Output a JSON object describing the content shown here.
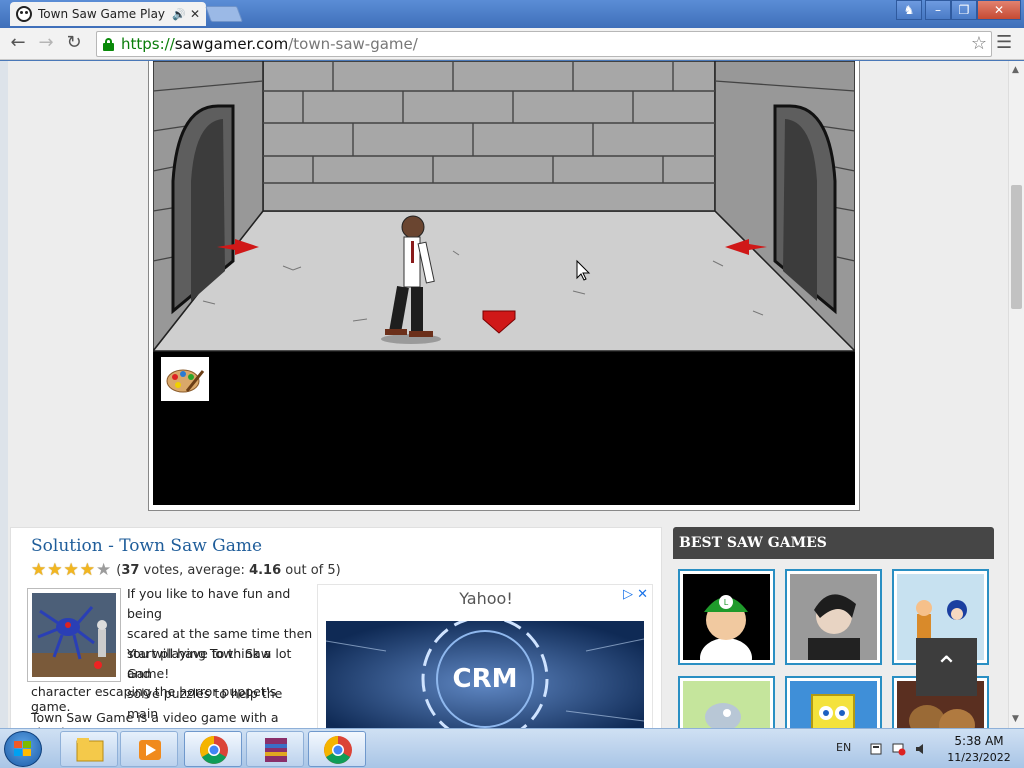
{
  "browser": {
    "tab": {
      "title": "Town Saw Game Play C",
      "audio_icon": "speaker-icon",
      "close_icon": "close-icon"
    },
    "window_controls": [
      "user-icon",
      "minimize-icon",
      "maximize-icon",
      "close-icon"
    ],
    "toolbar": {
      "url": {
        "scheme": "https://",
        "host": "sawgamer.com",
        "path": "/town-saw-game/"
      },
      "icons": [
        "back-icon",
        "forward-icon",
        "reload-icon",
        "lock-icon",
        "star-icon",
        "menu-icon"
      ]
    }
  },
  "game": {
    "navigation_arrows": [
      "left-arrow",
      "right-arrow",
      "down-arrow"
    ],
    "inventory_item": "palette-icon"
  },
  "article": {
    "title": "Solution - Town Saw Game",
    "rating": {
      "stars": 4,
      "max": 5,
      "paren_open": "(",
      "votes": "37",
      "votes_label": " votes, average: ",
      "average": "4.16",
      "suffix": " out of 5)"
    },
    "description_lines": [
      "If you like to have fun and being",
      "scared at the same time then",
      "start playing Town Saw Game!",
      "You will have to think a lot and",
      "solve puzzles to help the main"
    ],
    "description_tail": "character escaping the horror puppet’s game.",
    "description_next": "Town Saw Game is a video game with a simple"
  },
  "ad": {
    "title": "Yahoo!",
    "icons": [
      "adchoices-icon",
      "close-icon"
    ],
    "banner_text": "CRM"
  },
  "sidebar": {
    "header": "BEST SAW GAMES",
    "games": [
      {
        "name": "thumb-green-cap"
      },
      {
        "name": "thumb-dark-hair"
      },
      {
        "name": "thumb-puppets"
      },
      {
        "name": "thumb-cartoon"
      },
      {
        "name": "thumb-sponge"
      },
      {
        "name": "thumb-dogs"
      }
    ]
  },
  "back_to_top": {
    "icon": "chevron-up-icon",
    "label": "^"
  },
  "taskbar": {
    "start_icon": "windows-start-icon",
    "apps": [
      "file-explorer-icon",
      "media-player-icon",
      "chrome-icon",
      "archiver-icon",
      "chrome-icon"
    ],
    "language": "EN",
    "tray_icons": [
      "flag-icon",
      "network-icon",
      "volume-icon"
    ],
    "time": "5:38 AM",
    "date": "11/23/2022"
  }
}
